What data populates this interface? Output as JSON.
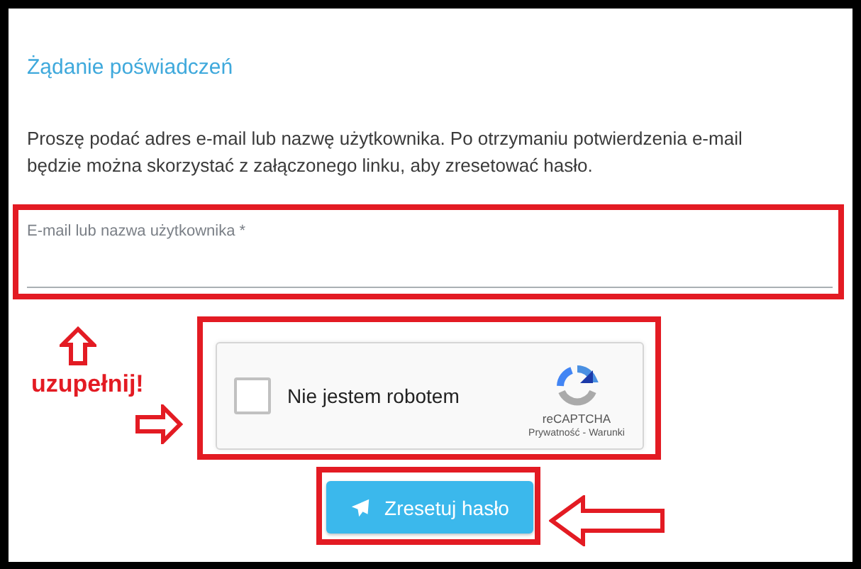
{
  "title": "Żądanie poświadczeń",
  "description": "Proszę podać adres e-mail lub nazwę użytkownika. Po otrzymaniu potwierdzenia e-mail będzie można skorzystać z załączonego linku, aby zresetować hasło.",
  "field": {
    "label": "E-mail lub nazwa użytkownika *"
  },
  "captcha": {
    "label": "Nie jestem robotem",
    "checked": false,
    "brand": "reCAPTCHA",
    "links": [
      "Prywatność",
      "-",
      "Warunki"
    ]
  },
  "button": {
    "label": "Zresetuj hasło"
  },
  "annotation": {
    "text": "uzupełnij!"
  }
}
